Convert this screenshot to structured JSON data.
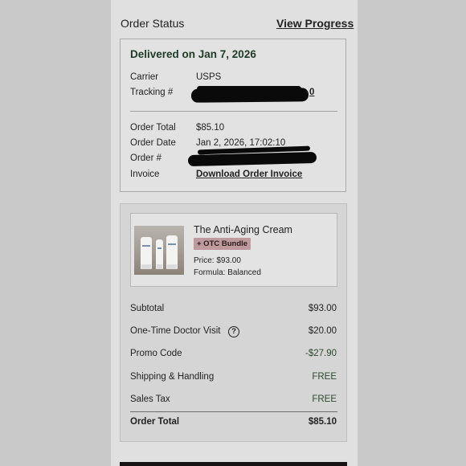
{
  "header": {
    "title": "Order Status",
    "link": "View Progress"
  },
  "status": {
    "delivered": "Delivered on Jan 7, 2026"
  },
  "shipping": {
    "carrier_label": "Carrier",
    "carrier_value": "USPS",
    "tracking_label": "Tracking #",
    "tracking_visible_tail": "0"
  },
  "order": {
    "total_label": "Order Total",
    "total_value": "$85.10",
    "date_label": "Order Date",
    "date_value": "Jan 2, 2026, 17:02:10",
    "number_label": "Order #",
    "invoice_label": "Invoice",
    "invoice_link": "Download Order Invoice"
  },
  "product": {
    "name": "The Anti-Aging Cream",
    "badge": "+ OTC Bundle",
    "price": "Price: $93.00",
    "formula": "Formula: Balanced",
    "image_icon": "product-tubes-photo"
  },
  "summary": {
    "subtotal_label": "Subtotal",
    "subtotal_value": "$93.00",
    "doctor_label": "One-Time Doctor Visit",
    "doctor_value": "$20.00",
    "help_glyph": "?",
    "promo_label": "Promo Code",
    "promo_value": "-$27.90",
    "shipping_label": "Shipping & Handling",
    "shipping_value": "FREE",
    "tax_label": "Sales Tax",
    "tax_value": "FREE",
    "total_label": "Order Total",
    "total_value": "$85.10"
  },
  "colors": {
    "accent_green": "#2d4a2d",
    "badge_bg": "#bf9a9c",
    "panel_bg": "#e0e0e0"
  }
}
